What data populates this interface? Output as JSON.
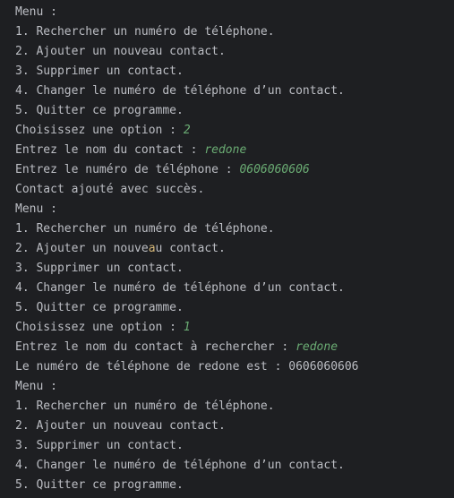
{
  "colors": {
    "background": "#1e1f22",
    "text": "#bcbec4",
    "user_input": "#6aab73",
    "highlight": "#d5b778"
  },
  "console": {
    "block1": {
      "menu_title": "Menu :",
      "option_1": "1. Rechercher un numéro de téléphone.",
      "option_2": "2. Ajouter un nouveau contact.",
      "option_3": "3. Supprimer un contact.",
      "option_4": "4. Changer le numéro de téléphone d’un contact.",
      "option_5": "5. Quitter ce programme.",
      "prompt_choice": "Choisissez une option : ",
      "input_choice": "2",
      "prompt_name": "Entrez le nom du contact : ",
      "input_name": "redone",
      "prompt_phone": "Entrez le numéro de téléphone : ",
      "input_phone": "0606060606",
      "result": "Contact ajouté avec succès."
    },
    "block2": {
      "menu_title": "Menu :",
      "option_1": "1. Rechercher un numéro de téléphone.",
      "option_2_part1": "2. Ajouter un nouve",
      "option_2_hl": "a",
      "option_2_part2": "u contact.",
      "option_3": "3. Supprimer un contact.",
      "option_4": "4. Changer le numéro de téléphone d’un contact.",
      "option_5": "5. Quitter ce programme.",
      "prompt_choice": "Choisissez une option : ",
      "input_choice": "1",
      "prompt_search": "Entrez le nom du contact à rechercher : ",
      "input_search": "redone",
      "result": "Le numéro de téléphone de redone est : 0606060606"
    },
    "block3": {
      "menu_title": "Menu :",
      "option_1": "1. Rechercher un numéro de téléphone.",
      "option_2": "2. Ajouter un nouveau contact.",
      "option_3": "3. Supprimer un contact.",
      "option_4": "4. Changer le numéro de téléphone d’un contact.",
      "option_5": "5. Quitter ce programme."
    }
  }
}
